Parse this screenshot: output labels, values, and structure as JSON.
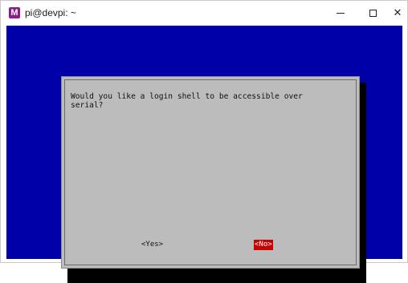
{
  "window": {
    "title": "pi@devpi: ~",
    "icon": "app-icon",
    "icon_letter": "M",
    "controls": {
      "minimize": "minimize-icon",
      "maximize": "maximize-icon",
      "close": "close-icon",
      "close_glyph": "✕"
    }
  },
  "terminal": {
    "background_color": "#0000a8"
  },
  "dialog": {
    "question": "Would you like a login shell to be accessible over\nserial?",
    "buttons": {
      "yes": "<Yes>",
      "no": "<No>"
    },
    "selected": "no",
    "selected_color": "#c80000"
  }
}
